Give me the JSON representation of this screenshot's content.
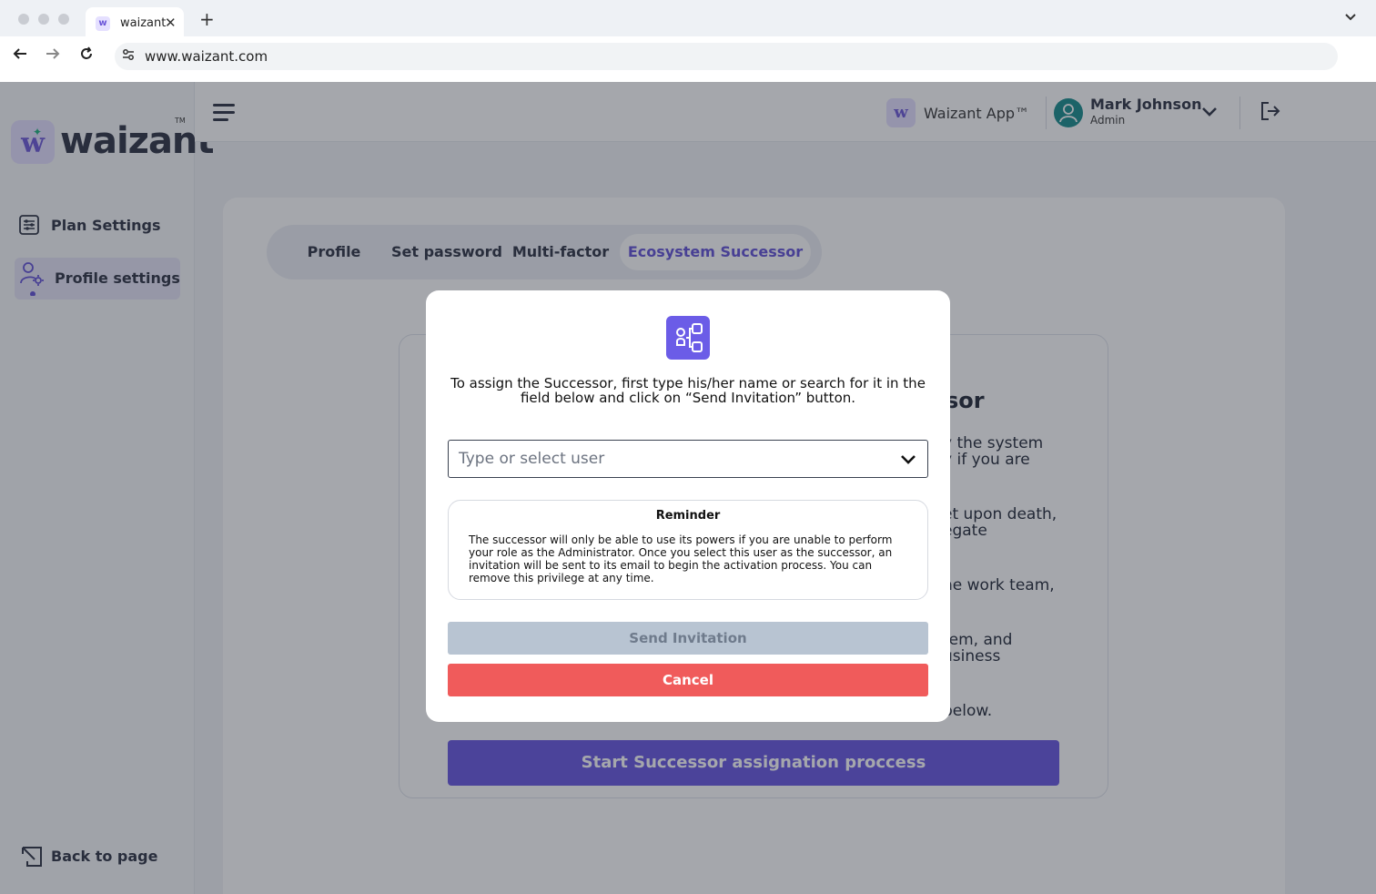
{
  "browser": {
    "tab_title": "waizant",
    "tab_close": "✕",
    "new_tab": "+",
    "url": "www.waizant.com",
    "tab_favicon_letter": "w",
    "tab_menu": "⌄"
  },
  "sidebar": {
    "logo_text": "waizant",
    "logo_mark": "w",
    "logo_tm": "TM",
    "items": [
      {
        "label": "Plan Settings",
        "icon": "sliders-icon",
        "active": false
      },
      {
        "label": "Profile settings",
        "icon": "user-gear-icon",
        "active": true
      }
    ],
    "back_label": "Back to page"
  },
  "topbar": {
    "app_chip_letter": "w",
    "app_name": "Waizant App™",
    "user_name": "Mark Johnson",
    "user_role": "Admin"
  },
  "content": {
    "tabs": [
      "Profile",
      "Set password",
      "Multi-factor",
      "Ecosystem Successor"
    ],
    "active_tab": "Ecosystem Successor",
    "title_fragment": "sor",
    "paragraph_fragments": [
      "y the system\ny if you are",
      "et upon death,\negate",
      "he work team,",
      "tem, and\nusiness",
      "below."
    ],
    "start_button": "Start Successor assignation proccess"
  },
  "modal": {
    "instruction": "To assign the Successor, first type his/her name or search for it in the field below and click on “Send Invitation” button.",
    "select_placeholder": "Type or select user",
    "reminder_title": "Reminder",
    "reminder_body": "The successor will only be able to use its powers if you are unable to perform your role as the Administrator. Once you select this user as the successor, an invitation will be sent to its email to begin the activation process. You can remove this privilege at any time.",
    "send_button": "Send Invitation",
    "cancel_button": "Cancel"
  },
  "colors": {
    "accent": "#6554e0",
    "cancel": "#f05b5b",
    "disabled": "#b8c4d2"
  }
}
